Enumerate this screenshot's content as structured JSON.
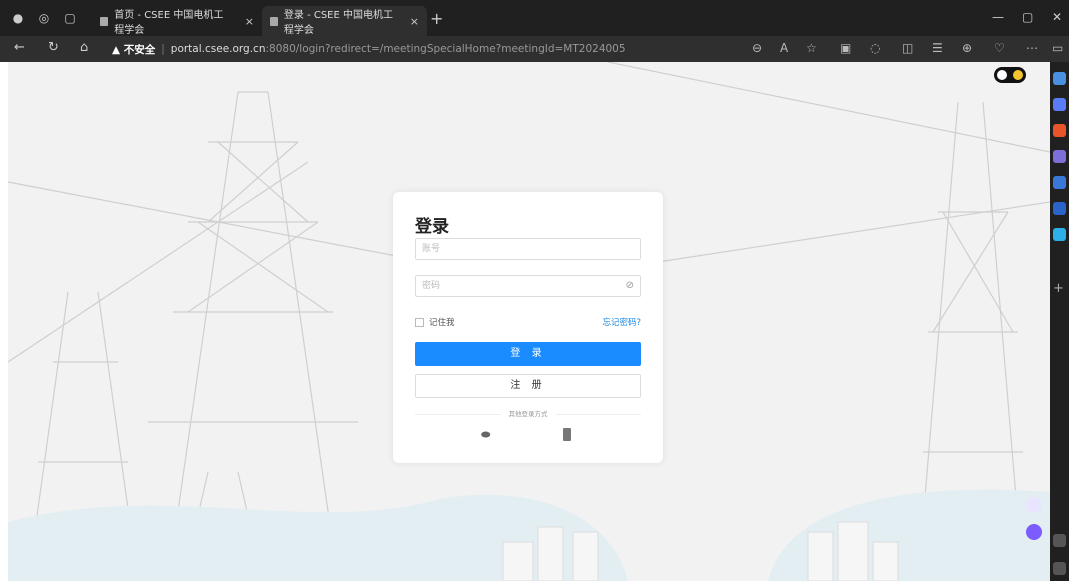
{
  "browser": {
    "tabs": [
      {
        "label": "首页 - CSEE 中国电机工程学会",
        "close": "×"
      },
      {
        "label": "登录 - CSEE 中国电机工程学会",
        "close": "×"
      }
    ],
    "new_tab": "+",
    "address": {
      "security": "▲ 不安全",
      "separator": "|",
      "host": "portal.csee.org.cn",
      "path": ":8080/login?redirect=/meetingSpecialHome?meetingId=MT2024005"
    }
  },
  "login": {
    "title": "登录",
    "username_placeholder": "账号",
    "password_placeholder": "密码",
    "remember_label": "记住我",
    "forgot_label": "忘记密码?",
    "login_button": "登 录",
    "register_button": "注 册",
    "other_methods": "其他登录方式"
  },
  "colors": {
    "primary": "#1a8cff",
    "browser_dark": "#202020",
    "toolbar": "#2f2f2f"
  },
  "icons": [
    "profile-icon",
    "workspaces-icon",
    "tab-actions-icon",
    "back-icon",
    "refresh-icon",
    "home-icon",
    "zoom-icon",
    "read-aloud-icon",
    "favorite-icon",
    "extension-icon",
    "copilot-icon",
    "split-screen-icon",
    "favorites-icon",
    "collections-icon",
    "more-icon",
    "wechat-icon",
    "phone-icon",
    "dark-mode-toggle"
  ]
}
